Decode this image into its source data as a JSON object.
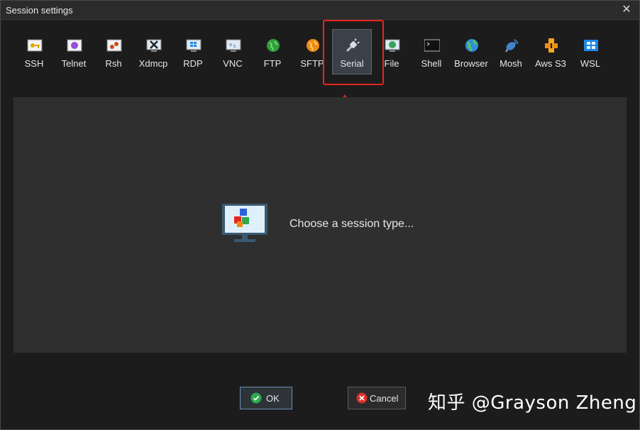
{
  "window": {
    "title": "Session settings",
    "close_glyph": "✕"
  },
  "toolbar": {
    "items": [
      {
        "label": "SSH",
        "icon": "ssh-key-icon"
      },
      {
        "label": "Telnet",
        "icon": "telnet-icon"
      },
      {
        "label": "Rsh",
        "icon": "rsh-icon"
      },
      {
        "label": "Xdmcp",
        "icon": "xdmcp-icon"
      },
      {
        "label": "RDP",
        "icon": "rdp-icon"
      },
      {
        "label": "VNC",
        "icon": "vnc-icon"
      },
      {
        "label": "FTP",
        "icon": "ftp-globe-icon"
      },
      {
        "label": "SFTP",
        "icon": "sftp-globe-icon"
      },
      {
        "label": "Serial",
        "icon": "serial-plug-icon"
      },
      {
        "label": "File",
        "icon": "file-icon"
      },
      {
        "label": "Shell",
        "icon": "shell-terminal-icon"
      },
      {
        "label": "Browser",
        "icon": "browser-globe-icon"
      },
      {
        "label": "Mosh",
        "icon": "mosh-satellite-icon"
      },
      {
        "label": "Aws S3",
        "icon": "aws-s3-icon"
      },
      {
        "label": "WSL",
        "icon": "wsl-windows-icon"
      }
    ],
    "selected": "Serial"
  },
  "panel": {
    "prompt": "Choose a session type..."
  },
  "buttons": {
    "ok": "OK",
    "cancel": "Cancel"
  },
  "watermark": "知乎 @Grayson Zheng",
  "colors": {
    "highlight": "#e5261f",
    "ok_green": "#2fa84f",
    "cancel_red": "#d9302c"
  }
}
